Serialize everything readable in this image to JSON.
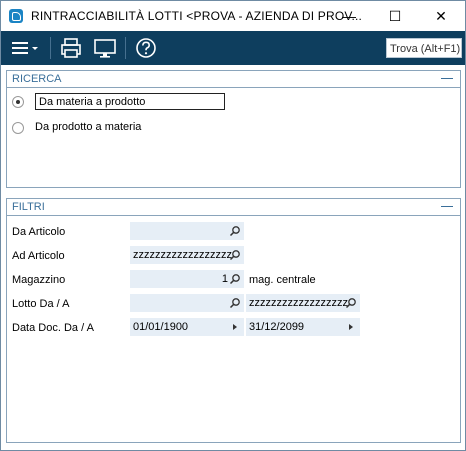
{
  "window": {
    "title": "RINTRACCIABILITÀ LOTTI <PROVA - AZIENDA DI PROV...",
    "minimize_glyph": "—",
    "maximize_glyph": "☐",
    "close_glyph": "✕"
  },
  "toolbar": {
    "find_label": "Trova (Alt+F1)",
    "icons": [
      "menu-icon",
      "printer-icon",
      "monitor-icon",
      "help-icon"
    ]
  },
  "ricerca": {
    "title": "RICERCA",
    "options": [
      {
        "label": "Da materia a prodotto",
        "selected": true
      },
      {
        "label": "Da prodotto a materia",
        "selected": false
      }
    ]
  },
  "filtri": {
    "title": "FILTRI",
    "da_articolo": {
      "label": "Da Articolo",
      "value": ""
    },
    "ad_articolo": {
      "label": "Ad Articolo",
      "value": "zzzzzzzzzzzzzzzzzz"
    },
    "magazzino": {
      "label": "Magazzino",
      "value": "1",
      "description": "mag. centrale"
    },
    "lotto": {
      "label": "Lotto Da / A",
      "from": "",
      "to": "zzzzzzzzzzzzzzzzzz"
    },
    "data_doc": {
      "label": "Data Doc. Da / A",
      "from": "01/01/1900",
      "to": "31/12/2099"
    }
  },
  "colors": {
    "toolbar_bg": "#0e3e5e",
    "field_bg": "#e6eef6",
    "panel_title": "#3a6f9a",
    "accent": "#1b84c4"
  }
}
